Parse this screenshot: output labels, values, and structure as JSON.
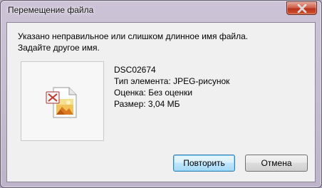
{
  "window": {
    "title": "Перемещение файла"
  },
  "message": {
    "line1": "Указано неправильное или слишком длинное имя файла.",
    "line2": "Задайте другое имя."
  },
  "file": {
    "name": "DSC02674",
    "type": "Тип элемента: JPEG-рисунок",
    "rating": "Оценка: Без оценки",
    "size": "Размер: 3,04 МБ",
    "icon": "image-file-icon"
  },
  "buttons": {
    "retry": "Повторить",
    "cancel": "Отмена"
  },
  "colors": {
    "close_button": "#c8452a",
    "default_button_border": "#3c7fb1"
  }
}
